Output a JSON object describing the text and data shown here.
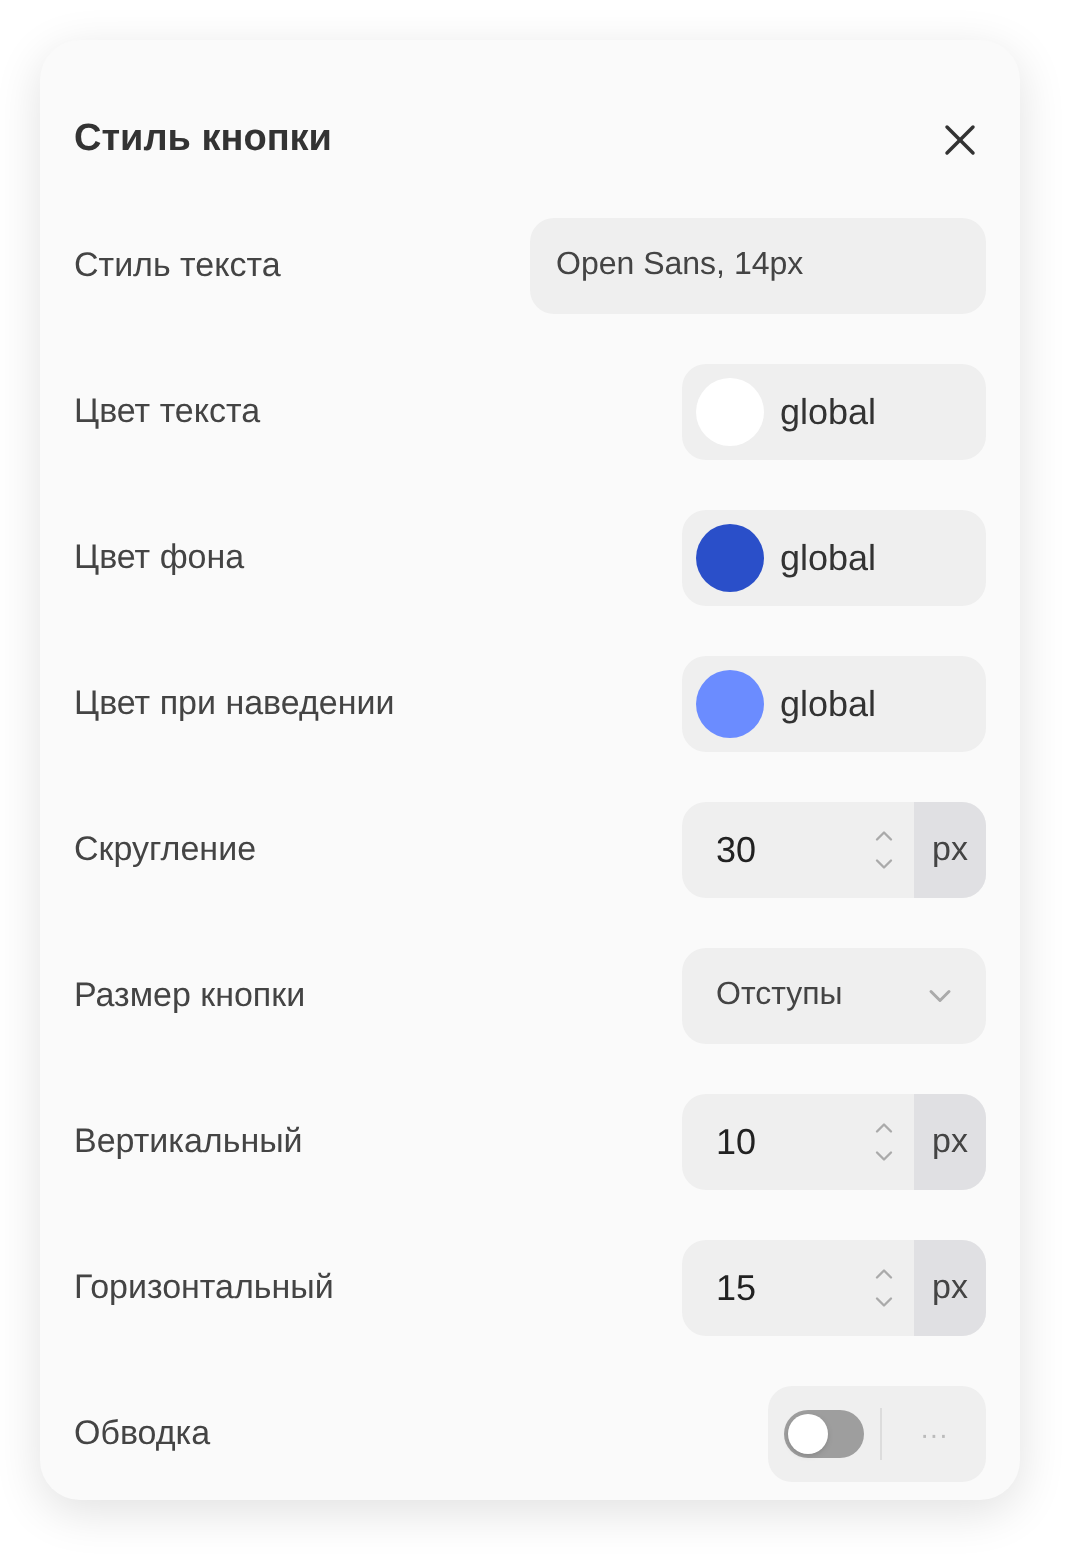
{
  "title": "Стиль кнопки",
  "rows": [
    {
      "kind": "text",
      "label": "Стиль текста",
      "value": "Open Sans, 14px"
    },
    {
      "kind": "color",
      "label": "Цвет текста",
      "value": "global",
      "color": "#ffffff"
    },
    {
      "kind": "color",
      "label": "Цвет фона",
      "value": "global",
      "color": "#2a4fc9"
    },
    {
      "kind": "color",
      "label": "Цвет при наведении",
      "value": "global",
      "color": "#6b8cff"
    },
    {
      "kind": "number",
      "label": "Скругление",
      "value": "30",
      "unit": "px"
    },
    {
      "kind": "select",
      "label": "Размер кнопки",
      "value": "Отступы"
    },
    {
      "kind": "number",
      "label": "Вертикальный",
      "value": "10",
      "unit": "px"
    },
    {
      "kind": "number",
      "label": "Горизонтальный",
      "value": "15",
      "unit": "px"
    },
    {
      "kind": "toggle",
      "label": "Обводка",
      "on": false,
      "more": "···"
    }
  ]
}
